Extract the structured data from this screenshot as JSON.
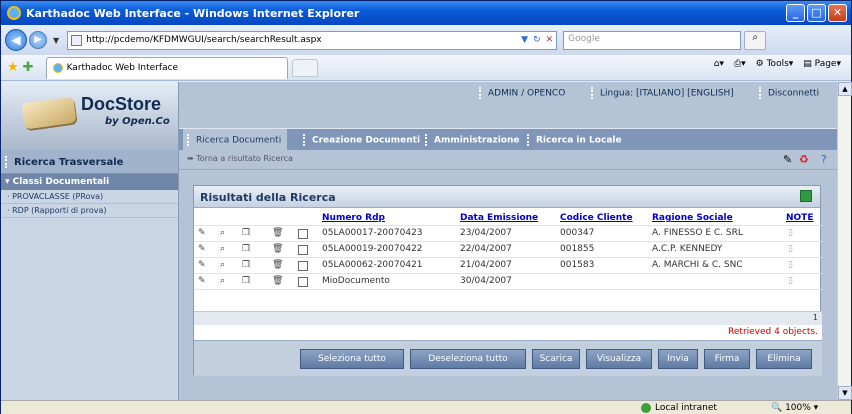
{
  "browser": {
    "title": "Karthadoc Web Interface - Windows Internet Explorer",
    "url": "http://pcdemo/KFDMWGUI/search/searchResult.aspx",
    "search_placeholder": "Google",
    "tab_title": "Karthadoc Web Interface",
    "commands": {
      "tools": "Tools",
      "page": "Page"
    },
    "status": {
      "zone": "Local intranet",
      "zoom": "100%"
    }
  },
  "app": {
    "logo_title": "DocStore",
    "logo_sub": "by Open.Co",
    "user": "ADMIN / OPENCO",
    "lang": "Lingua: [ITALIANO] [ENGLISH]",
    "logout": "Disconnetti",
    "menu": [
      "Ricerca Documenti",
      "Creazione Documenti",
      "Amministrazione",
      "Ricerca in Locale"
    ],
    "sidebar": {
      "header": "Ricerca Trasversale",
      "section": "Classi Documentali",
      "items": [
        "PROVACLASSE (PRova)",
        "RDP (Rapporti di prova)"
      ]
    },
    "breadcrumb": "Torna a risultato Ricerca"
  },
  "results": {
    "title": "Risultati della Ricerca",
    "columns": [
      "Numero Rdp",
      "Data Emissione",
      "Codice Cliente",
      "Ragione Sociale",
      "NOTE"
    ],
    "rows": [
      {
        "num": "05LA00017-20070423",
        "date": "23/04/2007",
        "code": "000347",
        "name": "A. FINESSO E C. SRL"
      },
      {
        "num": "05LA00019-20070422",
        "date": "22/04/2007",
        "code": "001855",
        "name": "A.C.P. KENNEDY"
      },
      {
        "num": "05LA00062-20070421",
        "date": "21/04/2007",
        "code": "001583",
        "name": "A. MARCHI & C. SNC"
      },
      {
        "num": "MioDocumento",
        "date": "30/04/2007",
        "code": "",
        "name": ""
      }
    ],
    "page": "1",
    "status": "Retrieved 4 objects.",
    "buttons": [
      "Seleziona tutto",
      "Deseleziona tutto",
      "Scarica",
      "Visualizza",
      "Invia",
      "Firma",
      "Elimina"
    ]
  }
}
